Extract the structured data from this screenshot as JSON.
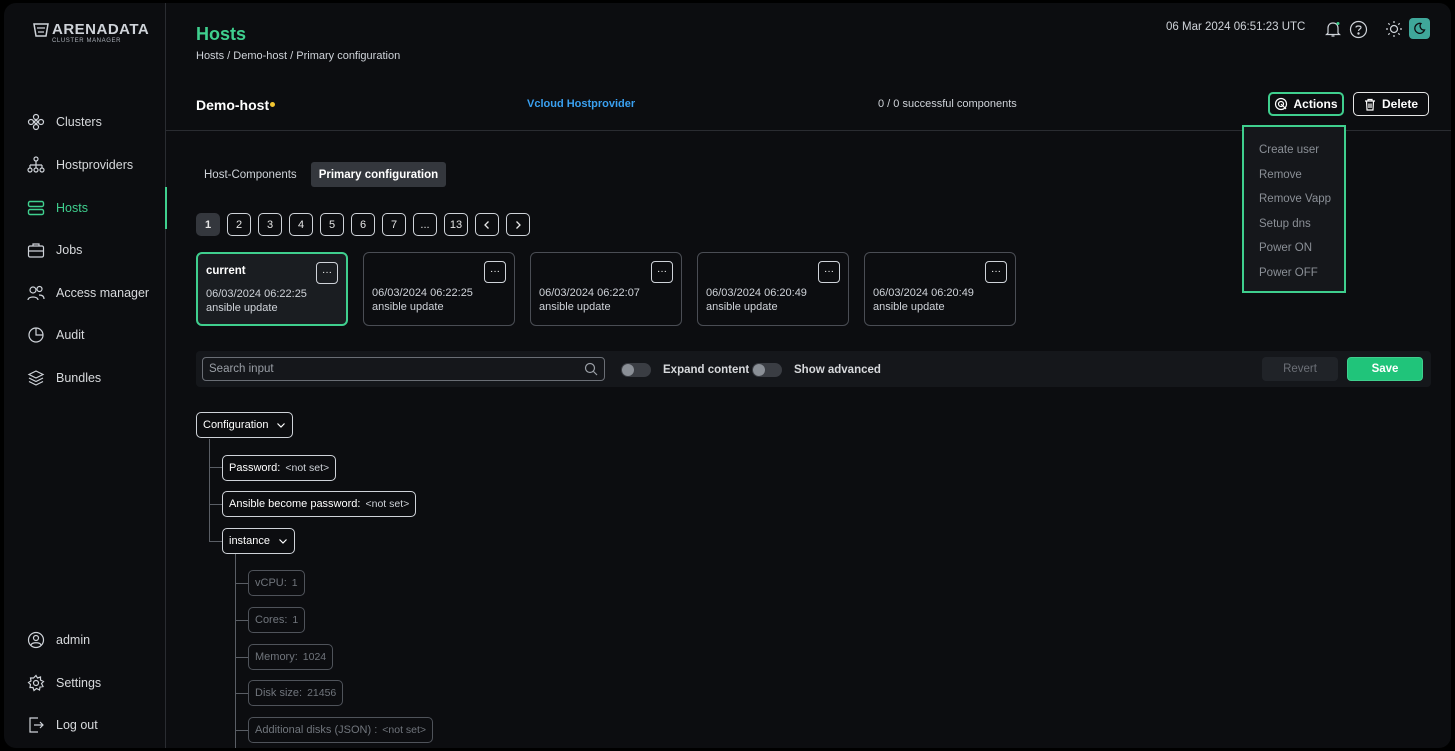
{
  "logo": {
    "main": "ARENADATA",
    "sub": "CLUSTER MANAGER"
  },
  "sidebar": {
    "items": [
      {
        "label": "Clusters",
        "icon": "clusters-icon"
      },
      {
        "label": "Hostproviders",
        "icon": "hostproviders-icon"
      },
      {
        "label": "Hosts",
        "icon": "hosts-icon",
        "active": true
      },
      {
        "label": "Jobs",
        "icon": "jobs-icon"
      },
      {
        "label": "Access manager",
        "icon": "access-manager-icon"
      },
      {
        "label": "Audit",
        "icon": "audit-icon"
      },
      {
        "label": "Bundles",
        "icon": "bundles-icon"
      }
    ],
    "bottom": [
      {
        "label": "admin",
        "icon": "user-icon"
      },
      {
        "label": "Settings",
        "icon": "gear-icon"
      },
      {
        "label": "Log out",
        "icon": "logout-icon"
      }
    ]
  },
  "header": {
    "title": "Hosts",
    "breadcrumb": "Hosts / Demo-host / Primary configuration",
    "datetime": "06 Mar 2024  06:51:23  UTC"
  },
  "host": {
    "name": "Demo-host",
    "status_color": "#f2c531",
    "provider": "Vcloud Hostprovider",
    "components": "0 / 0 successful components",
    "actions_label": "Actions",
    "delete_label": "Delete"
  },
  "actions_menu": [
    "Create user",
    "Remove",
    "Remove Vapp",
    "Setup dns",
    "Power ON",
    "Power OFF"
  ],
  "tabs": [
    {
      "label": "Host-Components",
      "active": false
    },
    {
      "label": "Primary configuration",
      "active": true
    }
  ],
  "pagination": {
    "pages": [
      "1",
      "2",
      "3",
      "4",
      "5",
      "6",
      "7",
      "...",
      "13"
    ],
    "current": "1",
    "prev": "‹",
    "next": "›"
  },
  "config_versions": [
    {
      "title": "current",
      "date": "06/03/2024 06:22:25",
      "description": "ansible update",
      "current": true
    },
    {
      "title": "",
      "date": "06/03/2024 06:22:25",
      "description": "ansible update"
    },
    {
      "title": "",
      "date": "06/03/2024 06:22:07",
      "description": "ansible update"
    },
    {
      "title": "",
      "date": "06/03/2024 06:20:49",
      "description": "ansible update"
    },
    {
      "title": "",
      "date": "06/03/2024 06:20:49",
      "description": "ansible update"
    }
  ],
  "card_menu_label": "···",
  "toolbar": {
    "search_placeholder": "Search input",
    "expand_label": "Expand content",
    "advanced_label": "Show advanced",
    "revert_label": "Revert",
    "save_label": "Save"
  },
  "tree": {
    "root": "Configuration",
    "password_key": "Password:",
    "password_val": "<not set>",
    "become_key": "Ansible become password:",
    "become_val": "<not set>",
    "instance": "instance",
    "vcpu_key": "vCPU:",
    "vcpu_val": "1",
    "cores_key": "Cores:",
    "cores_val": "1",
    "memory_key": "Memory:",
    "memory_val": "1024",
    "disk_key": "Disk size:",
    "disk_val": "21456",
    "addl_key": "Additional disks (JSON) :",
    "addl_val": "<not set>"
  },
  "colors": {
    "accent": "#3fcf8e",
    "link": "#3aa0f0",
    "background": "#0c0d10"
  }
}
